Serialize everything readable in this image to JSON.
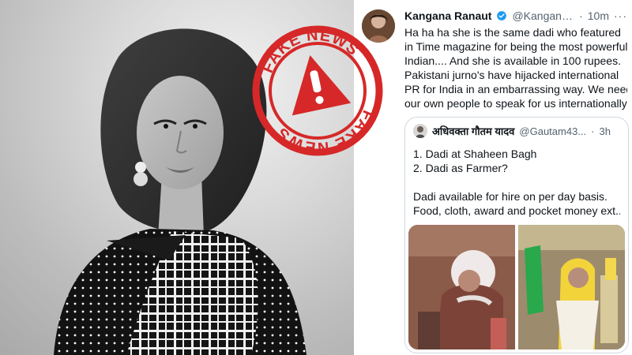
{
  "stamp": {
    "top_text": "FAKE NEWS",
    "bottom_text": "FAKE NEWS",
    "color": "#d62828"
  },
  "tweet": {
    "author_name": "Kangana Ranaut",
    "author_handle": "@KanganaTea...",
    "time": "10m",
    "more": "···",
    "verified_color": "#1d9bf0",
    "text_lines": [
      "Ha ha ha she is the same dadi who featured",
      "in Time magazine for being the most powerful",
      "Indian.... And she is available in 100 rupees.",
      "Pakistani jurno's have hijacked international",
      "PR for India in an embarrassing way. We need",
      "our own people to speak for us internationally."
    ]
  },
  "quote": {
    "author_name": "अधिवक्ता गौतम यादव",
    "author_handle": "@Gautam43...",
    "time": "3h",
    "separator": "·",
    "text_lines": [
      "1. Dadi at Shaheen Bagh",
      "2. Dadi as Farmer?",
      "",
      "Dadi available for hire on per day basis.",
      "Food, cloth, award and pocket money ext..."
    ]
  },
  "colors": {
    "text_primary": "#0f1419",
    "text_secondary": "#536471",
    "border": "#cfd9de",
    "stamp_red": "#d62828"
  },
  "icons": {
    "verified": "verified-badge-icon",
    "warning": "warning-triangle-icon"
  }
}
